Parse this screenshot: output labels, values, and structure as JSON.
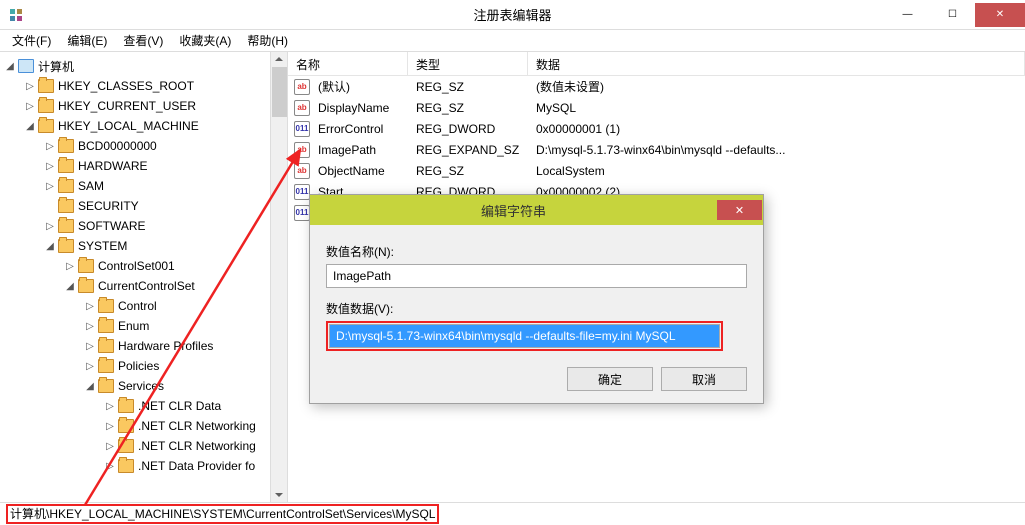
{
  "window": {
    "title": "注册表编辑器"
  },
  "menu": {
    "file": "文件(F)",
    "edit": "编辑(E)",
    "view": "查看(V)",
    "favorites": "收藏夹(A)",
    "help": "帮助(H)"
  },
  "tree": {
    "root": "计算机",
    "nodes": {
      "classes_root": "HKEY_CLASSES_ROOT",
      "current_user": "HKEY_CURRENT_USER",
      "local_machine": "HKEY_LOCAL_MACHINE",
      "bcd": "BCD00000000",
      "hardware": "HARDWARE",
      "sam": "SAM",
      "security": "SECURITY",
      "software": "SOFTWARE",
      "system": "SYSTEM",
      "controlset001": "ControlSet001",
      "currentcontrolset": "CurrentControlSet",
      "control": "Control",
      "enum": "Enum",
      "hardware_profiles": "Hardware Profiles",
      "policies": "Policies",
      "services": "Services",
      "net_clr_data": ".NET CLR Data",
      "net_clr_networking1": ".NET CLR Networking",
      "net_clr_networking2": ".NET CLR Networking",
      "net_data_provider": ".NET Data Provider fo"
    }
  },
  "list": {
    "headers": {
      "name": "名称",
      "type": "类型",
      "data": "数据"
    },
    "rows": [
      {
        "icon": "str",
        "name": "(默认)",
        "type": "REG_SZ",
        "data": "(数值未设置)"
      },
      {
        "icon": "str",
        "name": "DisplayName",
        "type": "REG_SZ",
        "data": "MySQL"
      },
      {
        "icon": "dw",
        "name": "ErrorControl",
        "type": "REG_DWORD",
        "data": "0x00000001 (1)"
      },
      {
        "icon": "str",
        "name": "ImagePath",
        "type": "REG_EXPAND_SZ",
        "data": "D:\\mysql-5.1.73-winx64\\bin\\mysqld --defaults..."
      },
      {
        "icon": "str",
        "name": "ObjectName",
        "type": "REG_SZ",
        "data": "LocalSystem"
      },
      {
        "icon": "dw",
        "name": "Start",
        "type": "REG_DWORD",
        "data": "0x00000002 (2)"
      }
    ],
    "extra_icon": "dw"
  },
  "dialog": {
    "title": "编辑字符串",
    "name_label": "数值名称(N):",
    "name_value": "ImagePath",
    "data_label": "数值数据(V):",
    "data_value": "D:\\mysql-5.1.73-winx64\\bin\\mysqld --defaults-file=my.ini MySQL",
    "ok": "确定",
    "cancel": "取消"
  },
  "statusbar": {
    "path": "计算机\\HKEY_LOCAL_MACHINE\\SYSTEM\\CurrentControlSet\\Services\\MySQL"
  },
  "icons": {
    "str_label": "ab",
    "dw_label": "011"
  }
}
